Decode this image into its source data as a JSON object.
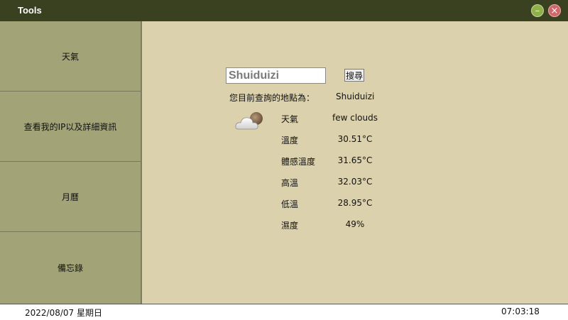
{
  "window": {
    "title": "Tools",
    "minimize_label": "–",
    "close_label": "×"
  },
  "sidebar": {
    "items": [
      {
        "label": "天氣"
      },
      {
        "label": "查看我的IP以及詳細資訊"
      },
      {
        "label": "月曆"
      },
      {
        "label": "備忘錄"
      }
    ]
  },
  "weather": {
    "search_value": "Shuiduizi",
    "search_button": "搜尋",
    "location_label": "您目前查詢的地點為：",
    "location_value": "Shuiduizi",
    "icon": "partly-cloudy-icon",
    "rows": [
      {
        "label": "天氣",
        "value": "few clouds"
      },
      {
        "label": "溫度",
        "value": "30.51°C"
      },
      {
        "label": "體感溫度",
        "value": "31.65°C"
      },
      {
        "label": "高溫",
        "value": "32.03°C"
      },
      {
        "label": "低溫",
        "value": "28.95°C"
      },
      {
        "label": "濕度",
        "value": "49%"
      }
    ]
  },
  "status": {
    "date": "2022/08/07 星期日",
    "time": "07:03:18"
  },
  "colors": {
    "titlebar": "#394120",
    "sidebar": "#a2a478",
    "main": "#dcd1ad",
    "minimize": "#8fb04a",
    "close": "#d0676a"
  }
}
